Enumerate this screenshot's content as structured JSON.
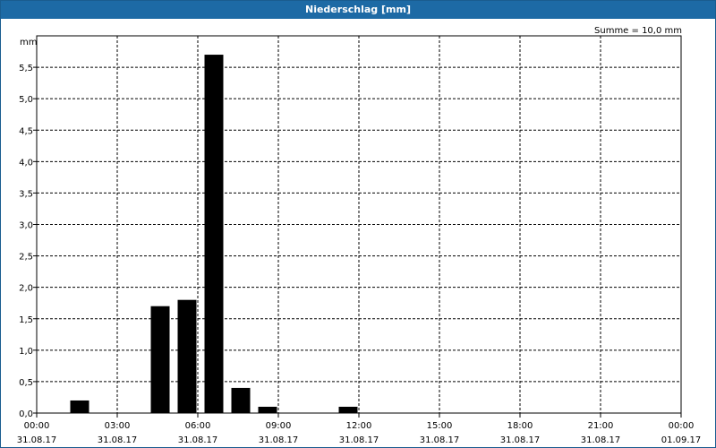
{
  "window": {
    "title": "Niederschlag [mm]"
  },
  "chart_data": {
    "type": "bar",
    "title": "Niederschlag [mm]",
    "ylabel": "mm",
    "annotation": "Summe = 10,0 mm",
    "ylim": [
      0,
      6.0
    ],
    "y_ticks": [
      {
        "value": 0.0,
        "label": "0,0"
      },
      {
        "value": 0.5,
        "label": "0,5"
      },
      {
        "value": 1.0,
        "label": "1,0"
      },
      {
        "value": 1.5,
        "label": "1,5"
      },
      {
        "value": 2.0,
        "label": "2,0"
      },
      {
        "value": 2.5,
        "label": "2,5"
      },
      {
        "value": 3.0,
        "label": "3,0"
      },
      {
        "value": 3.5,
        "label": "3,5"
      },
      {
        "value": 4.0,
        "label": "4,0"
      },
      {
        "value": 4.5,
        "label": "4,5"
      },
      {
        "value": 5.0,
        "label": "5,0"
      },
      {
        "value": 5.5,
        "label": "5,5"
      }
    ],
    "xlim_hours": [
      0,
      24
    ],
    "x_ticks": [
      {
        "hour": 0,
        "time": "00:00",
        "date": "31.08.17"
      },
      {
        "hour": 3,
        "time": "03:00",
        "date": "31.08.17"
      },
      {
        "hour": 6,
        "time": "06:00",
        "date": "31.08.17"
      },
      {
        "hour": 9,
        "time": "09:00",
        "date": "31.08.17"
      },
      {
        "hour": 12,
        "time": "12:00",
        "date": "31.08.17"
      },
      {
        "hour": 15,
        "time": "15:00",
        "date": "31.08.17"
      },
      {
        "hour": 18,
        "time": "18:00",
        "date": "31.08.17"
      },
      {
        "hour": 21,
        "time": "21:00",
        "date": "31.08.17"
      },
      {
        "hour": 24,
        "time": "00:00",
        "date": "01.09.17"
      }
    ],
    "bars": [
      {
        "start_hour": 1,
        "value": 0.2
      },
      {
        "start_hour": 4,
        "value": 1.7
      },
      {
        "start_hour": 5,
        "value": 1.8
      },
      {
        "start_hour": 6,
        "value": 5.7
      },
      {
        "start_hour": 7,
        "value": 0.4
      },
      {
        "start_hour": 8,
        "value": 0.1
      },
      {
        "start_hour": 11,
        "value": 0.1
      }
    ],
    "bar_color": "#000000",
    "grid": true,
    "grid_style": "dashed"
  }
}
